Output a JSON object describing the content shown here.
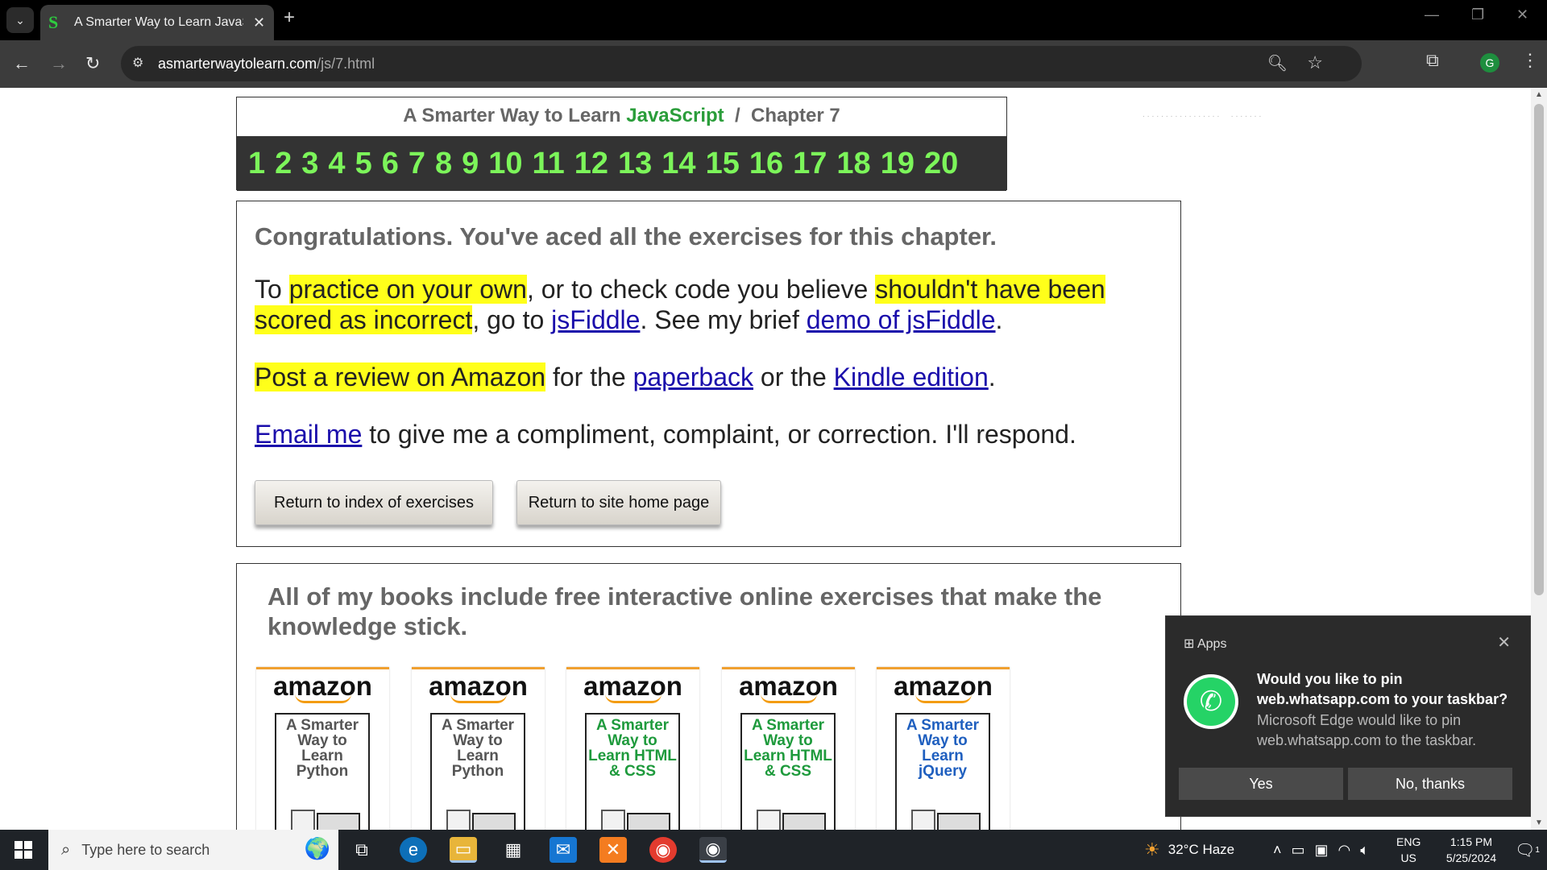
{
  "browser": {
    "tab_title": "A Smarter Way to Learn JavaScript",
    "tab_favicon": "S",
    "url_host": "asmarterwaytolearn.com",
    "url_path": "/js/7.html",
    "profile_initial": "G"
  },
  "chapter_header": {
    "prefix": "A Smarter Way to Learn ",
    "subject": "JavaScript",
    "separator": "/",
    "chapter": "Chapter 7",
    "numbers": [
      "1",
      "2",
      "3",
      "4",
      "5",
      "6",
      "7",
      "8",
      "9",
      "10",
      "11",
      "12",
      "13",
      "14",
      "15",
      "16",
      "17",
      "18",
      "19",
      "20"
    ]
  },
  "congrats": {
    "heading": "Congratulations. You've aced all the exercises for this chapter.",
    "p1_a": "To ",
    "p1_hl1": "practice on your own",
    "p1_b": ", or to check code you believe ",
    "p1_hl2": "shouldn't have been scored as incorrect",
    "p1_c": ", go to ",
    "p1_link1": "jsFiddle",
    "p1_d": ". See my brief ",
    "p1_link2": "demo of jsFiddle",
    "p1_e": ".",
    "p2_hl": "Post a review on Amazon",
    "p2_a": " for the ",
    "p2_link1": "paperback",
    "p2_b": " or the ",
    "p2_link2": "Kindle edition",
    "p2_c": ".",
    "p3_link": "Email me",
    "p3_a": " to give me a compliment, complaint, or correction. I'll respond.",
    "btn_index": "Return to index of exercises",
    "btn_home": "Return to site home page"
  },
  "books": {
    "heading": "All of my books include free interactive online exercises that make the knowledge stick.",
    "items": [
      {
        "brand": "amazon",
        "title": "A Smarter Way to Learn Python",
        "color": "#555555"
      },
      {
        "brand": "amazon",
        "title": "A Smarter Way to Learn Python",
        "color": "#555555"
      },
      {
        "brand": "amazon",
        "title": "A Smarter Way to Learn HTML & CSS",
        "color": "#1e9a3c"
      },
      {
        "brand": "amazon",
        "title": "A Smarter Way to Learn HTML & CSS",
        "color": "#1e9a3c"
      },
      {
        "brand": "amazon",
        "title": "A Smarter Way to Learn jQuery",
        "color": "#1f5fbf"
      }
    ]
  },
  "notification": {
    "app": "Apps",
    "heading": "Would you like to pin web.whatsapp.com to your taskbar?",
    "body": "Microsoft Edge would like to pin web.whatsapp.com to the taskbar.",
    "yes": "Yes",
    "no": "No, thanks"
  },
  "taskbar": {
    "search_placeholder": "Type here to search",
    "weather": "32°C  Haze",
    "lang1": "ENG",
    "lang2": "US",
    "time": "1:15 PM",
    "date": "5/25/2024",
    "notif_count": "1"
  }
}
